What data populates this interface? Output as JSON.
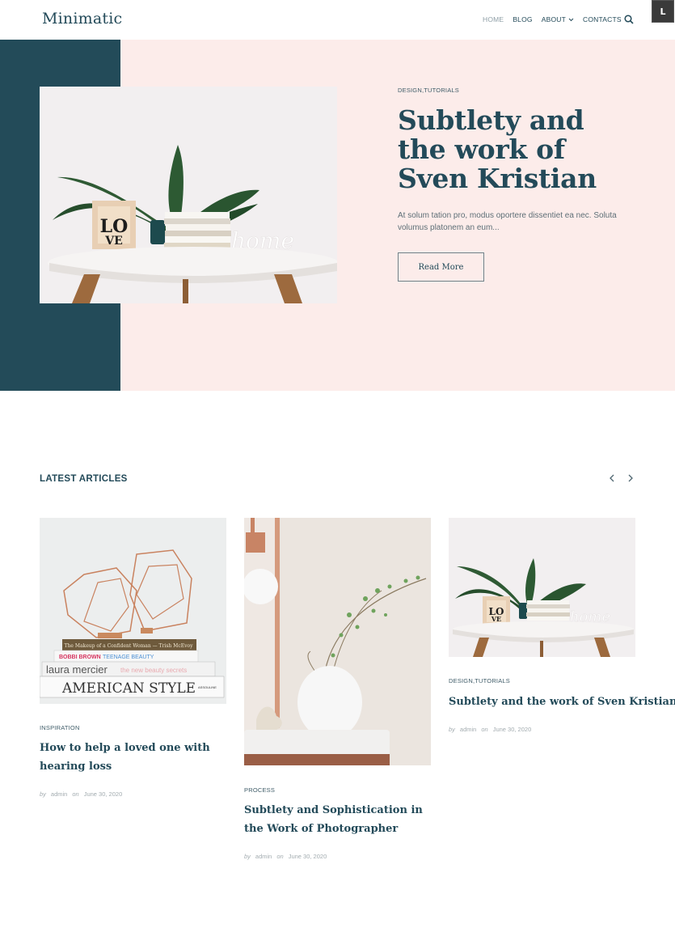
{
  "header": {
    "logo": "Minimatic",
    "nav": [
      {
        "label": "HOME",
        "active": true
      },
      {
        "label": "BLOG",
        "active": false
      },
      {
        "label": "ABOUT",
        "active": false,
        "has_dropdown": true
      },
      {
        "label": "CONTACTS",
        "active": false
      }
    ],
    "dropdown_icon": "chevron-down-icon",
    "search_icon": "search-icon",
    "corner_button": "L"
  },
  "hero": {
    "category": "DESIGN,TUTORIALS",
    "title": "Subtlety and the work of Sven Kristian",
    "excerpt": "At solum tation pro, modus oportere dissentiet ea nec. Soluta volumus platonem an eum...",
    "read_more": "Read More",
    "image_alt": "White round table with plant, LOVE frame, books and home sign"
  },
  "latest": {
    "title": "LATEST ARTICLES",
    "prev": "‹",
    "next": "›",
    "articles": [
      {
        "category": "INSPIRATION",
        "title": "How to help a loved one with hearing loss",
        "by": "by",
        "author": "admin",
        "on": "on",
        "date": "June 30, 2020",
        "image_alt": "Copper geometric lanterns on stacked books"
      },
      {
        "category": "PROCESS",
        "title": "Subtlety and Sophistication in the Work of Photographer",
        "by": "by",
        "author": "admin",
        "on": "on",
        "date": "June 30, 2020",
        "image_alt": "White vase with branches on marble table"
      },
      {
        "category": "DESIGN,TUTORIALS",
        "title": "Subtlety and the work of Sven Kristian",
        "by": "by",
        "author": "admin",
        "on": "on",
        "date": "June 30, 2020",
        "image_alt": "White round table with plant and decor"
      }
    ]
  },
  "colors": {
    "primary": "#234a59",
    "hero_bg": "#fcecea",
    "hero_block": "#234b59",
    "muted": "#a3acb0"
  }
}
